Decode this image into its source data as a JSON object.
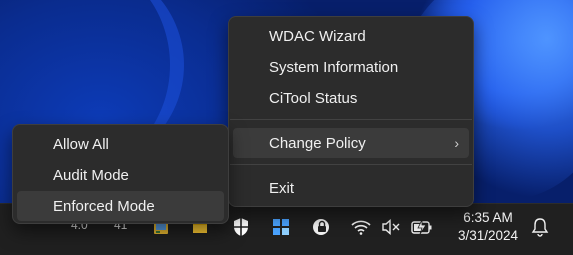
{
  "main_menu": {
    "items": [
      {
        "label": "WDAC Wizard"
      },
      {
        "label": "System Information"
      },
      {
        "label": "CiTool Status"
      },
      {
        "label": "Change Policy",
        "submenu_indicator": "›"
      },
      {
        "label": "Exit"
      }
    ]
  },
  "sub_menu": {
    "items": [
      {
        "label": "Allow All"
      },
      {
        "label": "Audit Mode"
      },
      {
        "label": "Enforced Mode"
      }
    ]
  },
  "taskbar": {
    "partial_labels": [
      "4.0",
      "41"
    ],
    "icons": [
      "app-icon",
      "folder-icon",
      "shield-icon",
      "grid-app-icon",
      "security-lock-icon",
      "wifi-icon",
      "speaker-muted-icon",
      "battery-charging-icon",
      "notification-bell-icon"
    ],
    "time": "6:35 AM",
    "date": "3/31/2024"
  },
  "colors": {
    "menu_bg": "#2c2c2c",
    "hover_bg": "#3b3b3b",
    "taskbar_bg": "#202020",
    "wallpaper_blue": "#0b2fa3"
  }
}
